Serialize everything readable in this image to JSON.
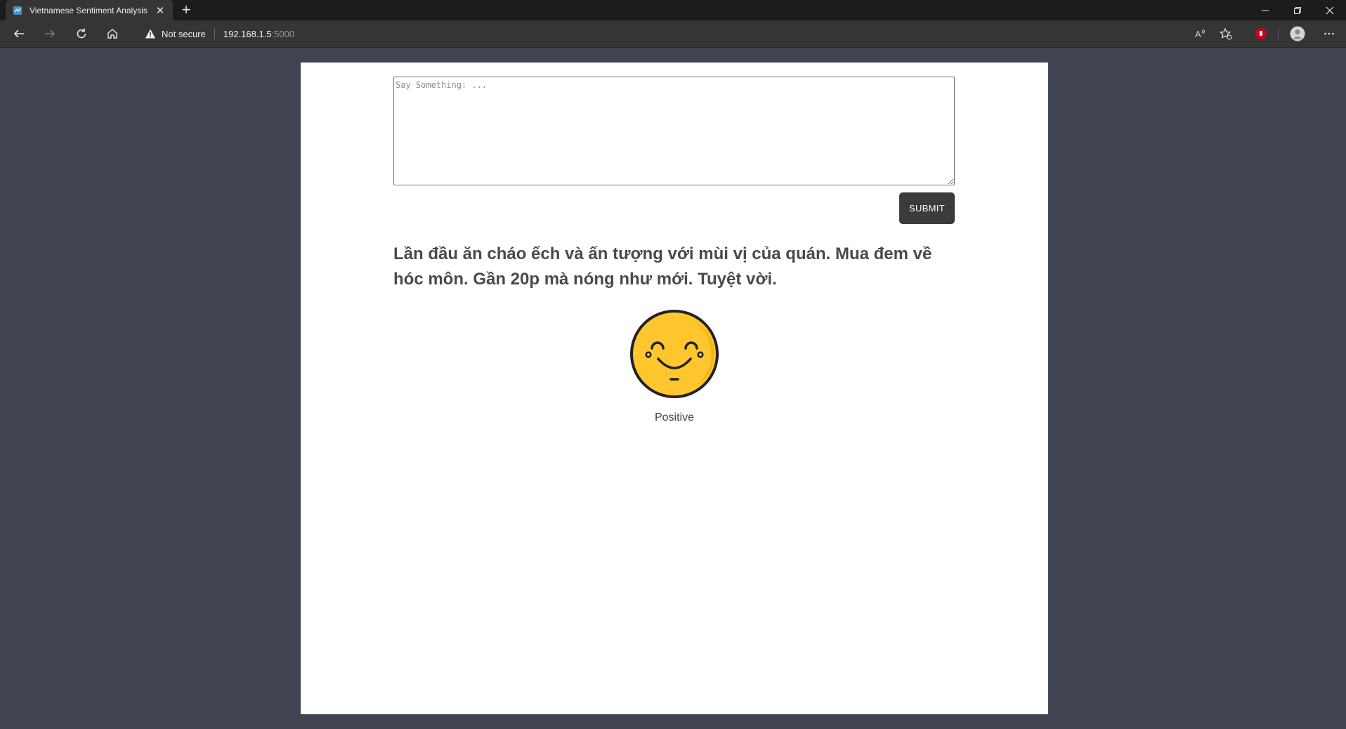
{
  "browser": {
    "tab_title": "Vietnamese Sentiment Analysis",
    "newtab_symbol": "+",
    "close_symbol": "✕",
    "security_label": "Not secure",
    "url_host": "192.168.1.5",
    "url_port": ":5000"
  },
  "form": {
    "placeholder": "Say Something: ...",
    "value": "",
    "submit_label": "SUBMIT"
  },
  "result": {
    "text": "Lần đầu ăn cháo ếch và ấn tượng với mùi vị của quán. Mua đem về hóc môn. Gần 20p mà nóng như mới. Tuyệt vời.",
    "sentiment": "Positive",
    "emoji_icon": "smiling-face-icon"
  },
  "colors": {
    "page_background": "#3f4450",
    "button": "#3b3b3b",
    "emoji_fill": "#ffc62e",
    "emoji_outline": "#222222"
  }
}
